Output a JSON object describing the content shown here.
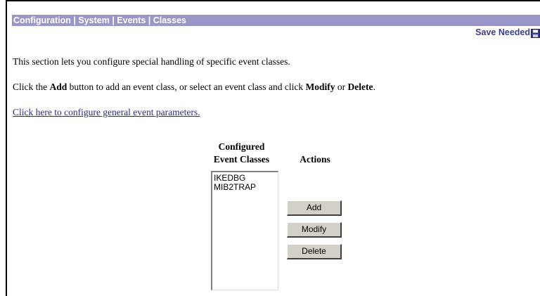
{
  "breadcrumb": "Configuration | System | Events | Classes",
  "status": {
    "save_needed": "Save Needed",
    "save_icon": "floppy-disk-icon"
  },
  "intro": {
    "line1": "This section lets you configure special handling of specific event classes.",
    "line2_a": "Click the ",
    "line2_add": "Add",
    "line2_b": " button to add an event class, or select an event class and click ",
    "line2_modify": "Modify",
    "line2_c": " or ",
    "line2_delete": "Delete",
    "line2_d": "."
  },
  "link": {
    "general_params": "Click here to configure general event parameters."
  },
  "table": {
    "header_classes_line1": "Configured",
    "header_classes_line2": "Event Classes",
    "header_actions": "Actions",
    "event_classes": [
      "IKEDBG",
      "MIB2TRAP"
    ]
  },
  "buttons": {
    "add": "Add",
    "modify": "Modify",
    "delete": "Delete"
  },
  "colors": {
    "breadcrumb_bg": "#9a97c8",
    "save_needed_text": "#3b3e8f",
    "link": "#2b2d7c"
  }
}
